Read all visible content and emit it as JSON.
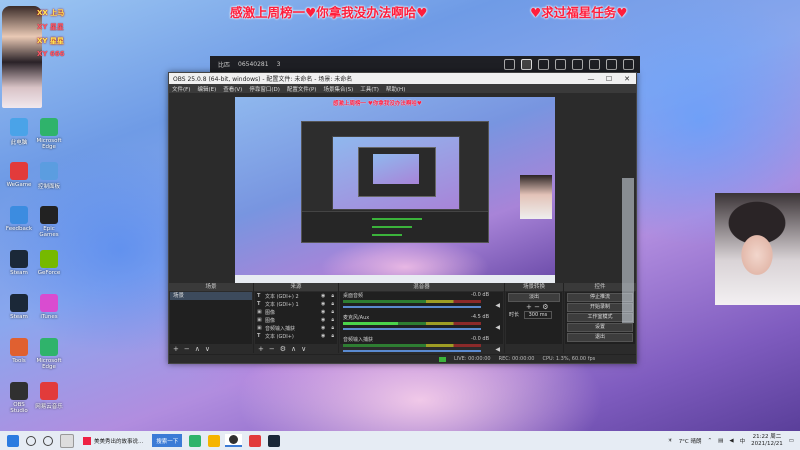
{
  "banners": {
    "left": "感激上周榜一♥你拿我没办法啊哈♥",
    "right": "♥求过福星任务♥"
  },
  "chat_overlay": [
    "XX 上马",
    "XY 星星",
    "XY 星星",
    "XY 666"
  ],
  "desktop_icons": [
    {
      "label": "此电脑",
      "color": "#4aa3e8"
    },
    {
      "label": "Microsoft Edge",
      "color": "#2fb36b"
    },
    {
      "label": "WeGame",
      "color": "#e23b3b"
    },
    {
      "label": "控制面板",
      "color": "#5b9de0"
    },
    {
      "label": "Feedback",
      "color": "#3c8ce0"
    },
    {
      "label": "Epic Games",
      "color": "#222222"
    },
    {
      "label": "Steam",
      "color": "#1b2838"
    },
    {
      "label": "GeForce",
      "color": "#76b900"
    },
    {
      "label": "Steam",
      "color": "#1b2838"
    },
    {
      "label": "iTunes",
      "color": "#d94cd0"
    },
    {
      "label": "Tools",
      "color": "#e06030"
    },
    {
      "label": "Microsoft Edge",
      "color": "#2fb36b"
    },
    {
      "label": "OBS Studio",
      "color": "#303030"
    },
    {
      "label": "网易云音乐",
      "color": "#e23b3b"
    }
  ],
  "stream_bar": {
    "name": "比匹",
    "id": "06540281",
    "viewers": "3"
  },
  "obs": {
    "title": "OBS 25.0.8 (64-bit, windows) - 配置文件: 未命名 - 场景: 未命名",
    "menu": [
      "文件(F)",
      "编辑(E)",
      "查看(V)",
      "停靠窗口(D)",
      "配置文件(P)",
      "场景集合(S)",
      "工具(T)",
      "帮助(H)"
    ],
    "preview_banner": "感激上周榜一 ♥你拿我没办法啊哈♥",
    "docks": {
      "scenes_title": "场景",
      "sources_title": "来源",
      "mixer_title": "混音器",
      "transitions_title": "场景转换",
      "controls_title": "控件"
    },
    "scenes": [
      "场景"
    ],
    "sources": [
      {
        "type": "T",
        "name": "文本 (GDI+) 2"
      },
      {
        "type": "T",
        "name": "文本 (GDI+) 1"
      },
      {
        "type": "▣",
        "name": "图像"
      },
      {
        "type": "▣",
        "name": "图像"
      },
      {
        "type": "▣",
        "name": "音频输入捕获"
      },
      {
        "type": "T",
        "name": "文本 (GDI+)"
      }
    ],
    "mixer": [
      {
        "name": "桌面音频",
        "level": "-0.0 dB"
      },
      {
        "name": "麦克风/Aux",
        "level": "-4.5 dB"
      },
      {
        "name": "音频输入捕获",
        "level": "-0.0 dB"
      }
    ],
    "transition": {
      "type": "淡出",
      "duration_label": "时长",
      "duration": "300 ms"
    },
    "controls": [
      "停止推流",
      "开始录制",
      "工作室模式",
      "设置",
      "退出"
    ],
    "status": {
      "live_label": "LIVE:",
      "live_time": "00:00:00",
      "rec_label": "REC:",
      "rec_time": "00:00:00",
      "cpu": "CPU: 1.3%, 60.00 fps"
    }
  },
  "taskbar": {
    "search": "搜索一下",
    "tasks": [
      {
        "label": "美美秀出的故事说...",
        "active": false
      },
      {
        "label": "OBS",
        "active": true
      }
    ],
    "tray": {
      "weather": "7°C 晴朗",
      "time": "21:22 周二",
      "date": "2021/12/21"
    }
  }
}
